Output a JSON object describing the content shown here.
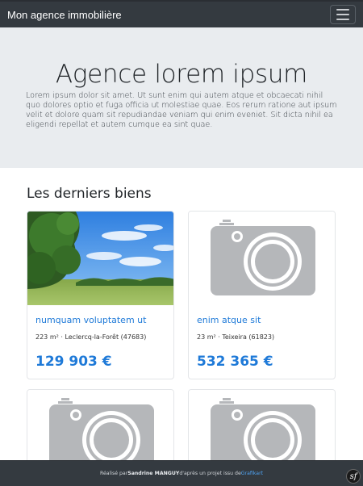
{
  "navbar": {
    "brand": "Mon agence immobilière",
    "toggle_icon": "hamburger-menu-icon"
  },
  "hero": {
    "title": "Agence lorem ipsum",
    "text": "Lorem ipsum dolor sit amet. Ut sunt enim qui autem atque et obcaecati nihil quo dolores optio et fuga officia ut molestiae quae. Eos rerum ratione aut ipsum velit et dolore quam sit repudiandae veniam qui enim eveniet. Sit dicta nihil ea eligendi repellat et autem cumque ea sint quae."
  },
  "section": {
    "title": "Les derniers biens"
  },
  "properties": [
    {
      "title": "numquam voluptatem ut",
      "meta": "223 m² · Leclercq-la-Forêt (47683)",
      "price": "129 903 €",
      "image": "landscape-photo"
    },
    {
      "title": "enim atque sit",
      "meta": "23 m² · Teixeira (61823)",
      "price": "532 365 €",
      "image": "camera-placeholder-icon"
    },
    {
      "title": "",
      "meta": "",
      "price": "",
      "image": "camera-placeholder-icon"
    },
    {
      "title": "",
      "meta": "",
      "price": "",
      "image": "camera-placeholder-icon"
    }
  ],
  "footer": {
    "prefix": "Réalisé par ",
    "author": "Sandrine MANGUY",
    "middle": " d'après un projet issu de ",
    "link": "Grafikart",
    "badge": "sf"
  },
  "colors": {
    "navbar": "#343a40",
    "hero_bg": "#e9ecef",
    "accent": "#1f7ad8",
    "placeholder_gray": "#b5b7ba"
  }
}
